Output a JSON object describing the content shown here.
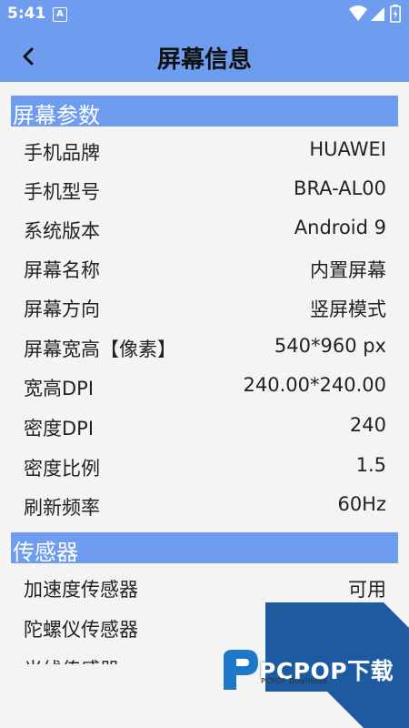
{
  "status": {
    "time": "5:41",
    "a_label": "A"
  },
  "header": {
    "title": "屏幕信息"
  },
  "sections": [
    {
      "title": "屏幕参数",
      "rows": [
        {
          "label": "手机品牌",
          "value": "HUAWEI"
        },
        {
          "label": "手机型号",
          "value": "BRA-AL00"
        },
        {
          "label": "系统版本",
          "value": "Android 9"
        },
        {
          "label": "屏幕名称",
          "value": "内置屏幕"
        },
        {
          "label": "屏幕方向",
          "value": "竖屏模式"
        },
        {
          "label": "屏幕宽高【像素】",
          "value": "540*960 px"
        },
        {
          "label": "宽高DPI",
          "value": "240.00*240.00"
        },
        {
          "label": "密度DPI",
          "value": "240"
        },
        {
          "label": "密度比例",
          "value": "1.5"
        },
        {
          "label": "刷新频率",
          "value": "60Hz"
        }
      ]
    },
    {
      "title": "传感器",
      "rows": [
        {
          "label": "加速度传感器",
          "value": "可用"
        },
        {
          "label": "陀螺仪传感器",
          "value": ""
        },
        {
          "label": "光线传感器",
          "value": ""
        }
      ]
    }
  ],
  "watermark": {
    "brand": "PCPOP下载",
    "sub": "PCPOP Download"
  },
  "colors": {
    "accent": "#6e9df0",
    "background": "#f4f4f4",
    "watermark_blue": "#1e5aa0"
  },
  "icons": [
    "back-arrow-icon",
    "wifi-icon",
    "signal-icon",
    "battery-icon",
    "text-a-icon",
    "pcpop-logo-icon"
  ]
}
